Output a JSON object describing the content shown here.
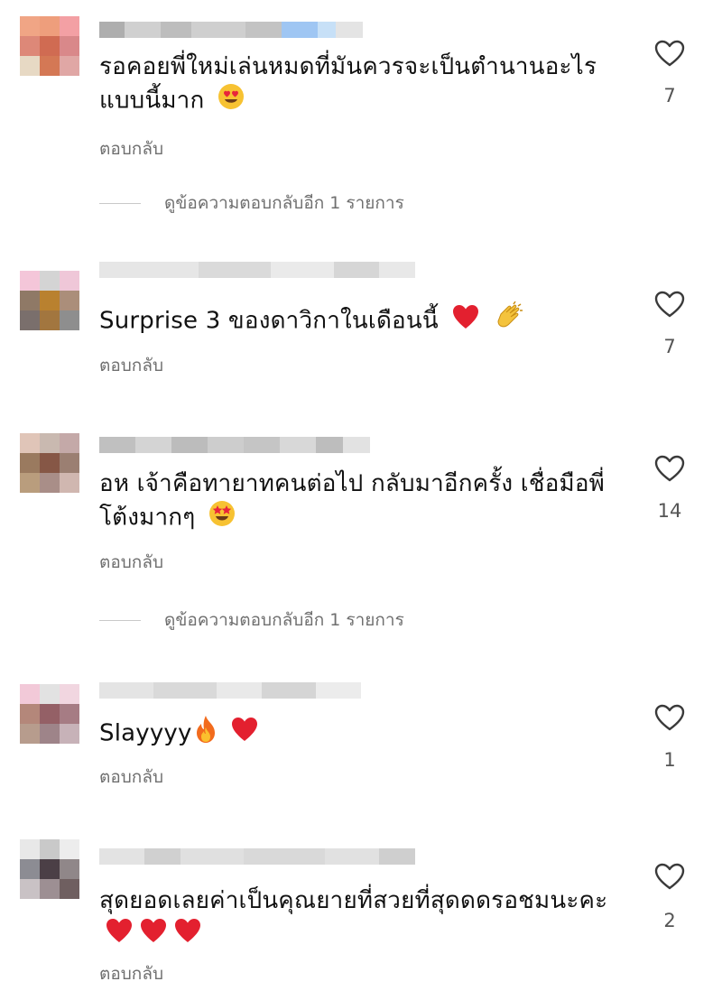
{
  "comments": [
    {
      "text": "รอคอยพี่ใหม่เล่นหมดที่มันควรจะเป็นตำนานอะไร แบบนี้มาก",
      "emojis": [
        "heart-eyes-emoji"
      ],
      "reply_label": "ตอบกลับ",
      "likes": "7",
      "more_replies": "ดูข้อความตอบกลับอีก 1 รายการ"
    },
    {
      "text": "Surprise 3 ของดาวิกาในเดือนนี้",
      "emojis": [
        "red-heart-emoji",
        "clapping-hands-emoji"
      ],
      "reply_label": "ตอบกลับ",
      "likes": "7"
    },
    {
      "text": "อห เจ้าคือทายาทคนต่อไป กลับมาอีกครั้ง เชื่อมือพี่โต้งมากๆ",
      "emojis": [
        "star-struck-emoji"
      ],
      "reply_label": "ตอบกลับ",
      "likes": "14",
      "more_replies": "ดูข้อความตอบกลับอีก 1 รายการ"
    },
    {
      "text": "Slayyyy",
      "emojis": [
        "fire-emoji",
        "red-heart-emoji"
      ],
      "reply_label": "ตอบกลับ",
      "likes": "1"
    },
    {
      "text": "สุดยอดเลยค่าเป็นคุณยายที่สวยที่สุดดดรอชมนะคะ",
      "emojis": [
        "red-heart-emoji",
        "red-heart-emoji",
        "red-heart-emoji"
      ],
      "reply_label": "ตอบกลับ",
      "likes": "2"
    }
  ],
  "colors": {
    "text": "#111111",
    "secondary": "#6f6f6f",
    "heart_outline": "#3a3a3a",
    "background": "#ffffff"
  },
  "icons": {
    "like": "heart-outline-icon"
  }
}
